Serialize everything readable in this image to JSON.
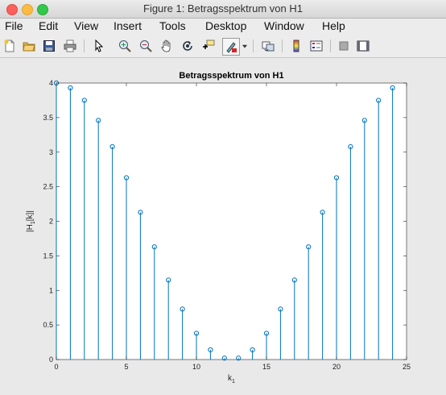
{
  "window": {
    "title": "Figure 1: Betragsspektrum von H1"
  },
  "menu": [
    "File",
    "Edit",
    "View",
    "Insert",
    "Tools",
    "Desktop",
    "Window",
    "Help"
  ],
  "toolbar": [
    "new-figure-icon",
    "open-file-icon",
    "save-icon",
    "print-icon",
    "edit-plot-icon",
    "zoom-in-icon",
    "zoom-out-icon",
    "pan-icon",
    "rotate-3d-icon",
    "data-cursor-icon",
    "brush-icon",
    "dropdown-arrow-icon",
    "link-plot-icon",
    "colorbar-icon",
    "legend-icon",
    "hide-plot-tools-icon",
    "show-plot-tools-icon"
  ],
  "colors": {
    "stem": "#0072bd",
    "background": "#e9e9e9",
    "axes_bg": "#ffffff"
  },
  "chart_data": {
    "type": "stem",
    "title": "Betragsspektrum von H1",
    "xlabel": "k",
    "xlabel_subscript": "1",
    "ylabel": "|H",
    "ylabel_subscript": "1",
    "ylabel_suffix": "[k]|",
    "xlim": [
      0,
      25
    ],
    "ylim": [
      0,
      4
    ],
    "xticks": [
      0,
      5,
      10,
      15,
      20,
      25
    ],
    "yticks": [
      0,
      0.5,
      1,
      1.5,
      2,
      2.5,
      3,
      3.5,
      4
    ],
    "x": [
      0,
      1,
      2,
      3,
      4,
      5,
      6,
      7,
      8,
      9,
      10,
      11,
      12,
      13,
      14,
      15,
      16,
      17,
      18,
      19,
      20,
      21,
      22,
      23,
      24
    ],
    "y": [
      4.0,
      3.93,
      3.75,
      3.46,
      3.08,
      2.63,
      2.13,
      1.63,
      1.15,
      0.73,
      0.38,
      0.14,
      0.02,
      0.02,
      0.14,
      0.38,
      0.73,
      1.15,
      1.63,
      2.13,
      2.63,
      3.08,
      3.46,
      3.75,
      3.93
    ],
    "grid": false
  }
}
